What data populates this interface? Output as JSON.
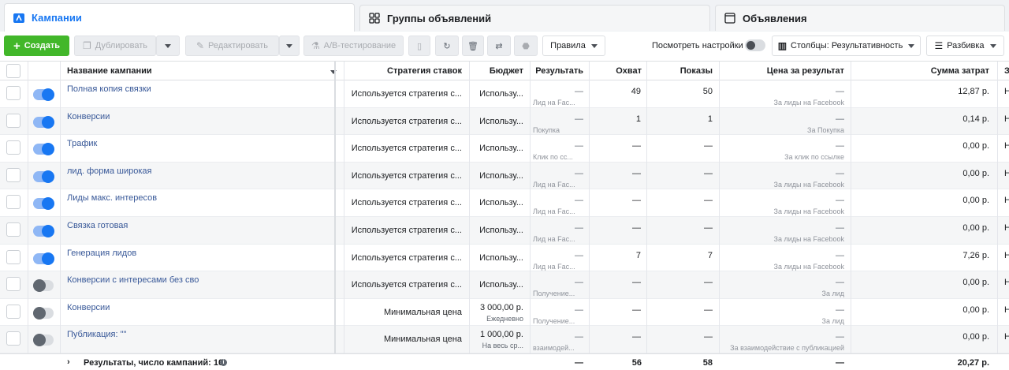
{
  "tabs": [
    {
      "label": "Кампании",
      "icon": "campaign-icon"
    },
    {
      "label": "Группы объявлений",
      "icon": "grid-icon"
    },
    {
      "label": "Объявления",
      "icon": "ad-icon"
    }
  ],
  "toolbar": {
    "create_label": "Создать",
    "duplicate_label": "Дублировать",
    "edit_label": "Редактировать",
    "ab_label": "A/B-тестирование",
    "rules_label": "Правила",
    "view_settings_label": "Посмотреть настройки",
    "columns_label": "Столбцы: Результативность",
    "breakdown_label": "Разбивка"
  },
  "table": {
    "headers": {
      "name": "Название кампании",
      "strategy": "Стратегия ставок",
      "budget": "Бюджет",
      "result": "Результать",
      "reach": "Охват",
      "impressions": "Показы",
      "cpr": "Цена за результат",
      "spend": "Сумма затрат",
      "extra": "З"
    },
    "rows": [
      {
        "on": true,
        "name": "Полная копия связки",
        "strategy": "Используется стратегия с...",
        "budget": "Использу...",
        "budget_sub": "",
        "result": "—",
        "result_sub": "Лид на Fac...",
        "reach": "49",
        "impressions": "50",
        "cpr": "—",
        "cpr_sub": "За лиды на Facebook",
        "spend": "12,87 р.",
        "extra": "Н"
      },
      {
        "on": true,
        "name": "Конверсии",
        "strategy": "Используется стратегия с...",
        "budget": "Использу...",
        "budget_sub": "",
        "result": "—",
        "result_sub": "Покупка",
        "reach": "1",
        "impressions": "1",
        "cpr": "—",
        "cpr_sub": "За Покупка",
        "spend": "0,14 р.",
        "extra": "Н"
      },
      {
        "on": true,
        "name": "Трафик",
        "strategy": "Используется стратегия с...",
        "budget": "Использу...",
        "budget_sub": "",
        "result": "—",
        "result_sub": "Клик по сс...",
        "reach": "—",
        "impressions": "—",
        "cpr": "—",
        "cpr_sub": "За клик по ссылке",
        "spend": "0,00 р.",
        "extra": "Н"
      },
      {
        "on": true,
        "name": "лид. форма широкая",
        "strategy": "Используется стратегия с...",
        "budget": "Использу...",
        "budget_sub": "",
        "result": "—",
        "result_sub": "Лид на Fac...",
        "reach": "—",
        "impressions": "—",
        "cpr": "—",
        "cpr_sub": "За лиды на Facebook",
        "spend": "0,00 р.",
        "extra": "Н"
      },
      {
        "on": true,
        "name": "Лиды макс. интересов",
        "strategy": "Используется стратегия с...",
        "budget": "Использу...",
        "budget_sub": "",
        "result": "—",
        "result_sub": "Лид на Fac...",
        "reach": "—",
        "impressions": "—",
        "cpr": "—",
        "cpr_sub": "За лиды на Facebook",
        "spend": "0,00 р.",
        "extra": "Н"
      },
      {
        "on": true,
        "name": "Связка готовая",
        "strategy": "Используется стратегия с...",
        "budget": "Использу...",
        "budget_sub": "",
        "result": "—",
        "result_sub": "Лид на Fac...",
        "reach": "—",
        "impressions": "—",
        "cpr": "—",
        "cpr_sub": "За лиды на Facebook",
        "spend": "0,00 р.",
        "extra": "Н"
      },
      {
        "on": true,
        "name": "Генерация лидов",
        "strategy": "Используется стратегия с...",
        "budget": "Использу...",
        "budget_sub": "",
        "result": "—",
        "result_sub": "Лид на Fac...",
        "reach": "7",
        "impressions": "7",
        "cpr": "—",
        "cpr_sub": "За лиды на Facebook",
        "spend": "7,26 р.",
        "extra": "Н"
      },
      {
        "on": false,
        "name": "Конверсии с интересами без сво",
        "strategy": "Используется стратегия с...",
        "budget": "Использу...",
        "budget_sub": "",
        "result": "—",
        "result_sub": "Получение...",
        "reach": "—",
        "impressions": "—",
        "cpr": "—",
        "cpr_sub": "За лид",
        "spend": "0,00 р.",
        "extra": "Н"
      },
      {
        "on": false,
        "name": "Конверсии",
        "strategy": "Минимальная цена",
        "budget": "3 000,00 р.",
        "budget_sub": "Ежедневно",
        "result": "—",
        "result_sub": "Получение...",
        "reach": "—",
        "impressions": "—",
        "cpr": "—",
        "cpr_sub": "За лид",
        "spend": "0,00 р.",
        "extra": "Н"
      },
      {
        "on": false,
        "name": "Публикация: \"\"",
        "strategy": "Минимальная цена",
        "budget": "1 000,00 р.",
        "budget_sub": "На весь ср...",
        "result": "—",
        "result_sub": "взаимодей...",
        "reach": "—",
        "impressions": "—",
        "cpr": "—",
        "cpr_sub": "За взаимодействие с публикацией",
        "spend": "0,00 р.",
        "extra": "Н"
      }
    ],
    "footer": {
      "label": "Результаты, число кампаний: 10",
      "result": "—",
      "reach": "56",
      "impressions": "58",
      "cpr": "—",
      "spend": "20,27 р."
    }
  }
}
